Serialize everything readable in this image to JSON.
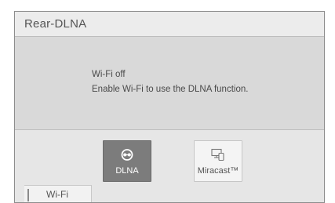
{
  "header": {
    "title": "Rear-DLNA"
  },
  "message": {
    "line1": "Wi-Fi off",
    "line2": "Enable Wi-Fi to use the DLNA function."
  },
  "sources": [
    {
      "label": "DLNA",
      "icon": "dlna-icon",
      "selected": true
    },
    {
      "label": "Miracast™",
      "icon": "miracast-icon",
      "selected": false
    }
  ],
  "footer": {
    "wifi_tab_label": "Wi-Fi"
  }
}
